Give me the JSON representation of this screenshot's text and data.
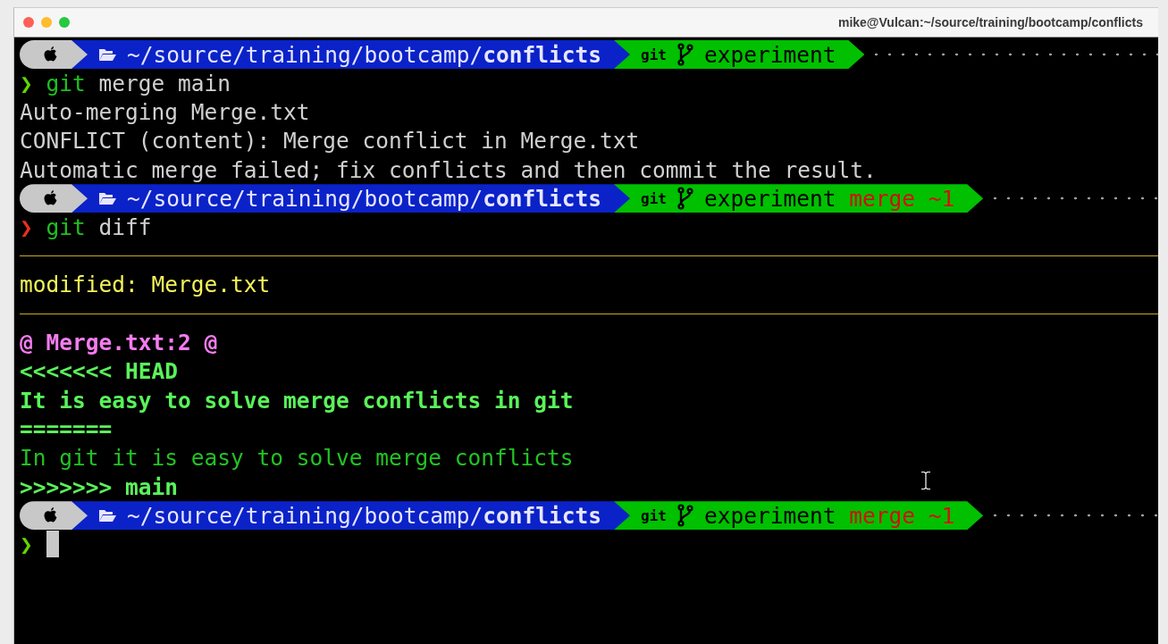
{
  "window": {
    "title": "mike@Vulcan:~/source/training/bootcamp/conflicts"
  },
  "lines": [
    {
      "kind": "prompt",
      "path": "~/source/training/bootcamp/**conflicts**",
      "vcs": "git",
      "branch": "experiment"
    },
    {
      "kind": "command",
      "symbol": "❯",
      "success": true,
      "program": "git",
      "args": "merge main"
    },
    {
      "kind": "output",
      "text": "Auto-merging Merge.txt"
    },
    {
      "kind": "output",
      "text": "CONFLICT (content): Merge conflict in Merge.txt"
    },
    {
      "kind": "output",
      "text": "Automatic merge failed; fix conflicts and then commit the result."
    },
    {
      "kind": "prompt",
      "path": "~/source/training/bootcamp/**conflicts**",
      "vcs": "git",
      "branch": "experiment",
      "status": "merge ~1"
    },
    {
      "kind": "command",
      "symbol": "❯",
      "success": false,
      "program": "git",
      "args": "diff"
    },
    {
      "kind": "rule"
    },
    {
      "kind": "file",
      "text": "modified: Merge.txt"
    },
    {
      "kind": "rule"
    },
    {
      "kind": "hunk",
      "text": "@ Merge.txt:2 @"
    },
    {
      "kind": "ours",
      "text": "<<<<<<< HEAD"
    },
    {
      "kind": "ours",
      "text": "It is easy to solve merge conflicts in git"
    },
    {
      "kind": "ours",
      "text": "======="
    },
    {
      "kind": "theirs",
      "text": "In git it is easy to solve merge conflicts"
    },
    {
      "kind": "ours",
      "text": ">>>>>>> main"
    },
    {
      "kind": "prompt",
      "path": "~/source/training/bootcamp/**conflicts**",
      "vcs": "git",
      "branch": "experiment",
      "status": "merge ~1"
    },
    {
      "kind": "command",
      "symbol": "❯",
      "success": true,
      "cursor": true
    }
  ]
}
